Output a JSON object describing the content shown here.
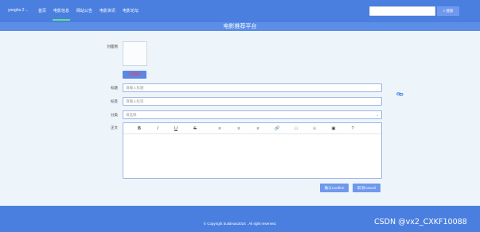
{
  "nav": {
    "user": "yonghu 2",
    "items": [
      "首页",
      "电影信息",
      "网站公告",
      "电影资讯",
      "电影论坛"
    ],
    "search_placeholder": "",
    "search_label": "搜索"
  },
  "title": "电影推荐平台",
  "form": {
    "cover_label": "封面图",
    "upload_label": "上传图片",
    "title_label": "标题",
    "title_placeholder": "请输入标题",
    "tags_label": "标签",
    "tags_placeholder": "请输入标签",
    "category_label": "分类",
    "category_value": "请选择",
    "body_label": "正文",
    "toolbar": [
      "B",
      "I",
      "U",
      "S",
      "≡",
      "≡",
      "≡",
      "🔗",
      "□",
      "☺",
      "▣",
      "?"
    ],
    "confirm_label": "确认Confirm",
    "cancel_label": "取消Cancel"
  },
  "footer": {
    "copyright": "© Copyright buildmax2024 . All right reserved.",
    "watermark": "CSDN @vx2_CXKF10088"
  },
  "colors": {
    "nav_bg": "#4a7fe0",
    "title_band": "#5c8ee8",
    "button": "#6f98ef",
    "page_bg": "#eef5fa"
  }
}
